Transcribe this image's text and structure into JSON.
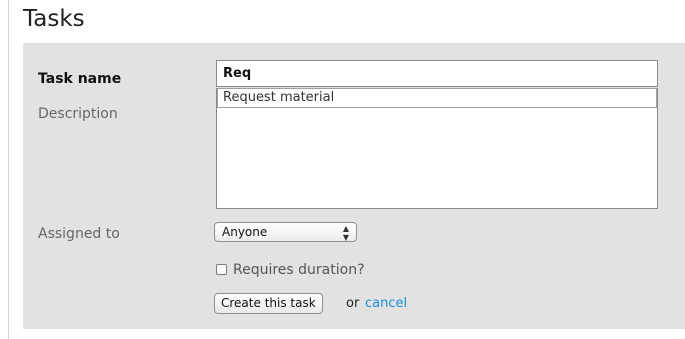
{
  "page": {
    "title": "Tasks"
  },
  "form": {
    "task_name": {
      "label": "Task name",
      "value": "Req",
      "autocomplete_suggestion": "Request material"
    },
    "description": {
      "label": "Description",
      "value": ""
    },
    "assigned_to": {
      "label": "Assigned to",
      "selected": "Anyone"
    },
    "requires_duration": {
      "label": "Requires duration?",
      "checked": false
    },
    "actions": {
      "create_label": "Create this task",
      "or_text": "or",
      "cancel_label": "cancel"
    }
  },
  "colors": {
    "panel_background": "#e2e2e2",
    "link": "#1a8fd9"
  }
}
